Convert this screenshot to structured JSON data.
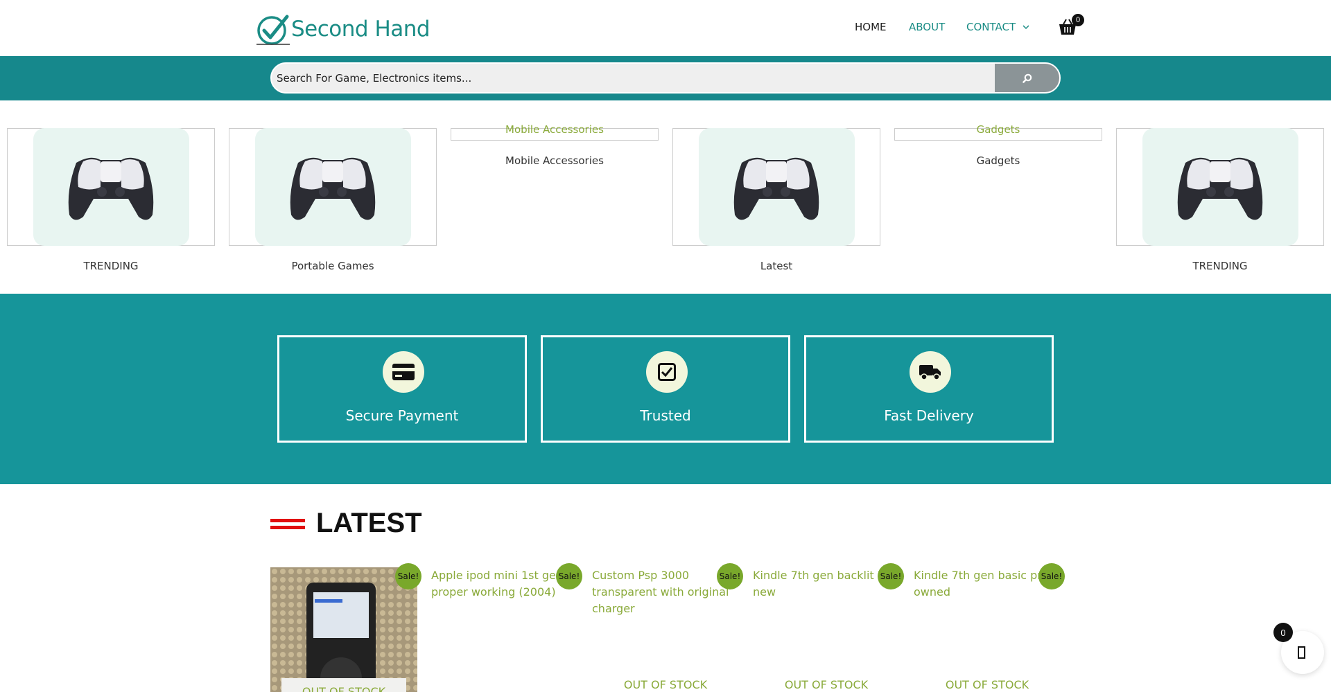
{
  "brand": {
    "name": "Second Hand",
    "logo_icon": "checkmark-circle-icon",
    "color": "#1a8c85"
  },
  "nav": {
    "home": "HOME",
    "about": "ABOUT",
    "contact": "CONTACT",
    "cart_count": "0"
  },
  "search": {
    "placeholder": "Search For Game, Electronics items...",
    "button_icon": "search-icon"
  },
  "categories": [
    {
      "label": "TRENDING",
      "image": "controller"
    },
    {
      "label": "Portable Games",
      "image": "controller"
    },
    {
      "label": "Mobile Accessories",
      "image_alt": "Mobile Accessories"
    },
    {
      "label": "Latest",
      "image": "controller"
    },
    {
      "label": "Gadgets",
      "image_alt": "Gadgets"
    },
    {
      "label": "TRENDING",
      "image": "controller"
    }
  ],
  "features": [
    {
      "label": "Secure Payment",
      "icon": "credit-card-icon"
    },
    {
      "label": "Trusted",
      "icon": "checkbox-icon"
    },
    {
      "label": "Fast Delivery",
      "icon": "truck-icon"
    }
  ],
  "latest": {
    "title": "LATEST",
    "sale_badge": "Sale!",
    "out_of_stock": "OUT OF STOCK",
    "products": [
      {
        "alt": ""
      },
      {
        "alt": "Apple ipod mini 1st gen proper working (2004)"
      },
      {
        "alt": "Custom Psp 3000 transparent with original charger"
      },
      {
        "alt": "Kindle 7th gen backlit like new"
      },
      {
        "alt": "Kindle 7th gen basic pre owned"
      }
    ]
  },
  "floating_cart": {
    "count": "0"
  },
  "colors": {
    "teal": "#16888c",
    "teal_features": "#16959a",
    "accent_red": "#e10e0e",
    "sale_green": "#79a82b",
    "link_green": "#8aaa3a"
  }
}
